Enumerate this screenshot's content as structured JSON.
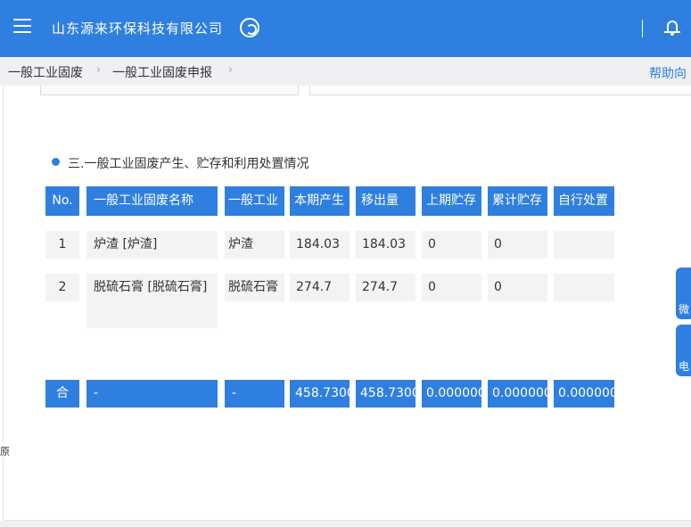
{
  "header": {
    "company": "山东源来环保科技有限公司"
  },
  "breadcrumb": {
    "items": [
      "一般工业固废",
      "一般工业固废申报"
    ],
    "help": "帮助向"
  },
  "prev_row": {
    "label": "",
    "value": ""
  },
  "section": {
    "title": "三.一般工业固废产生、贮存和利用处置情况"
  },
  "table": {
    "headers": [
      "No.",
      "一般工业固废名称",
      "一般工业",
      "本期产生",
      "移出量",
      "上期贮存",
      "累计贮存",
      "自行处置"
    ],
    "rows": [
      [
        "1",
        "炉渣 [炉渣]",
        "炉渣",
        "184.03",
        "184.03",
        "0",
        "0",
        ""
      ],
      [
        "2",
        "脱硫石膏 [脱硫石膏]",
        "脱硫石膏",
        "274.7",
        "274.7",
        "0",
        "0",
        ""
      ]
    ],
    "total": [
      "合",
      "-",
      "-",
      "458.7300",
      "458.7300",
      "0.000000",
      "0.000000",
      "0.000000"
    ]
  },
  "side_tabs": [
    "微",
    "电"
  ],
  "left_glyph": "原"
}
